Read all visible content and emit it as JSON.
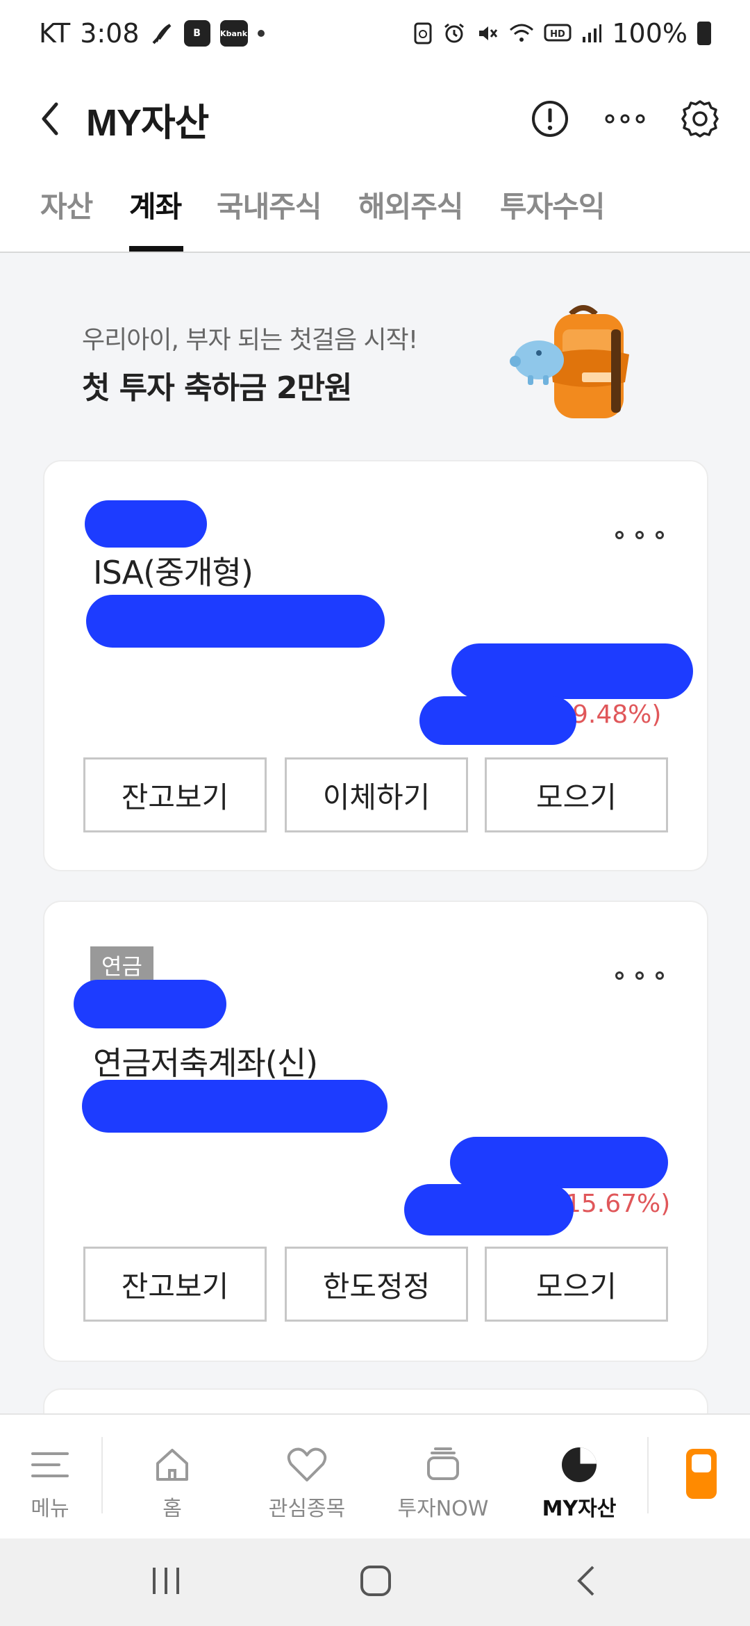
{
  "status_bar": {
    "carrier": "KT",
    "time": "3:08",
    "battery_pct": "100%",
    "left_icons": [
      "app-icon-1",
      "b-app-icon",
      "kbank-app-icon",
      "notification-dot"
    ],
    "left_badge_b": "B",
    "left_badge_kbank": "Kbank",
    "right_icons": [
      "recycle-icon",
      "alarm-icon",
      "mute-icon",
      "wifi-icon",
      "hd-icon",
      "signal-icon",
      "battery-icon"
    ]
  },
  "header": {
    "title": "MY자산",
    "icons": [
      "back-icon",
      "info-icon",
      "more-icon",
      "settings-icon"
    ]
  },
  "tabs": [
    {
      "label": "자산",
      "active": false
    },
    {
      "label": "계좌",
      "active": true
    },
    {
      "label": "국내주식",
      "active": false
    },
    {
      "label": "해외주식",
      "active": false
    },
    {
      "label": "투자수익",
      "active": false
    }
  ],
  "promo": {
    "subtitle": "우리아이, 부자 되는 첫걸음 시작!",
    "title": "첫 투자 축하금 2만원",
    "image": "backpack-piggybank-illustration"
  },
  "accounts": [
    {
      "badge": "",
      "name": "ISA(중개형)",
      "return_pct": "9.48%)",
      "buttons": [
        "잔고보기",
        "이체하기",
        "모으기"
      ]
    },
    {
      "badge": "연금",
      "name": "연금저축계좌(신)",
      "return_pct": "15.67%)",
      "buttons": [
        "잔고보기",
        "한도정정",
        "모으기"
      ]
    }
  ],
  "bottom_nav": [
    {
      "label": "메뉴",
      "icon": "menu-icon",
      "active": false
    },
    {
      "label": "홈",
      "icon": "home-icon",
      "active": false
    },
    {
      "label": "관심종목",
      "icon": "heart-icon",
      "active": false
    },
    {
      "label": "투자NOW",
      "icon": "stack-icon",
      "active": false
    },
    {
      "label": "MY자산",
      "icon": "pie-chart-icon",
      "active": true
    }
  ],
  "colors": {
    "accent_orange": "#ff8a00",
    "return_red": "#e0575a",
    "redaction_blue": "#1d3cff",
    "badge_gray": "#999999"
  }
}
